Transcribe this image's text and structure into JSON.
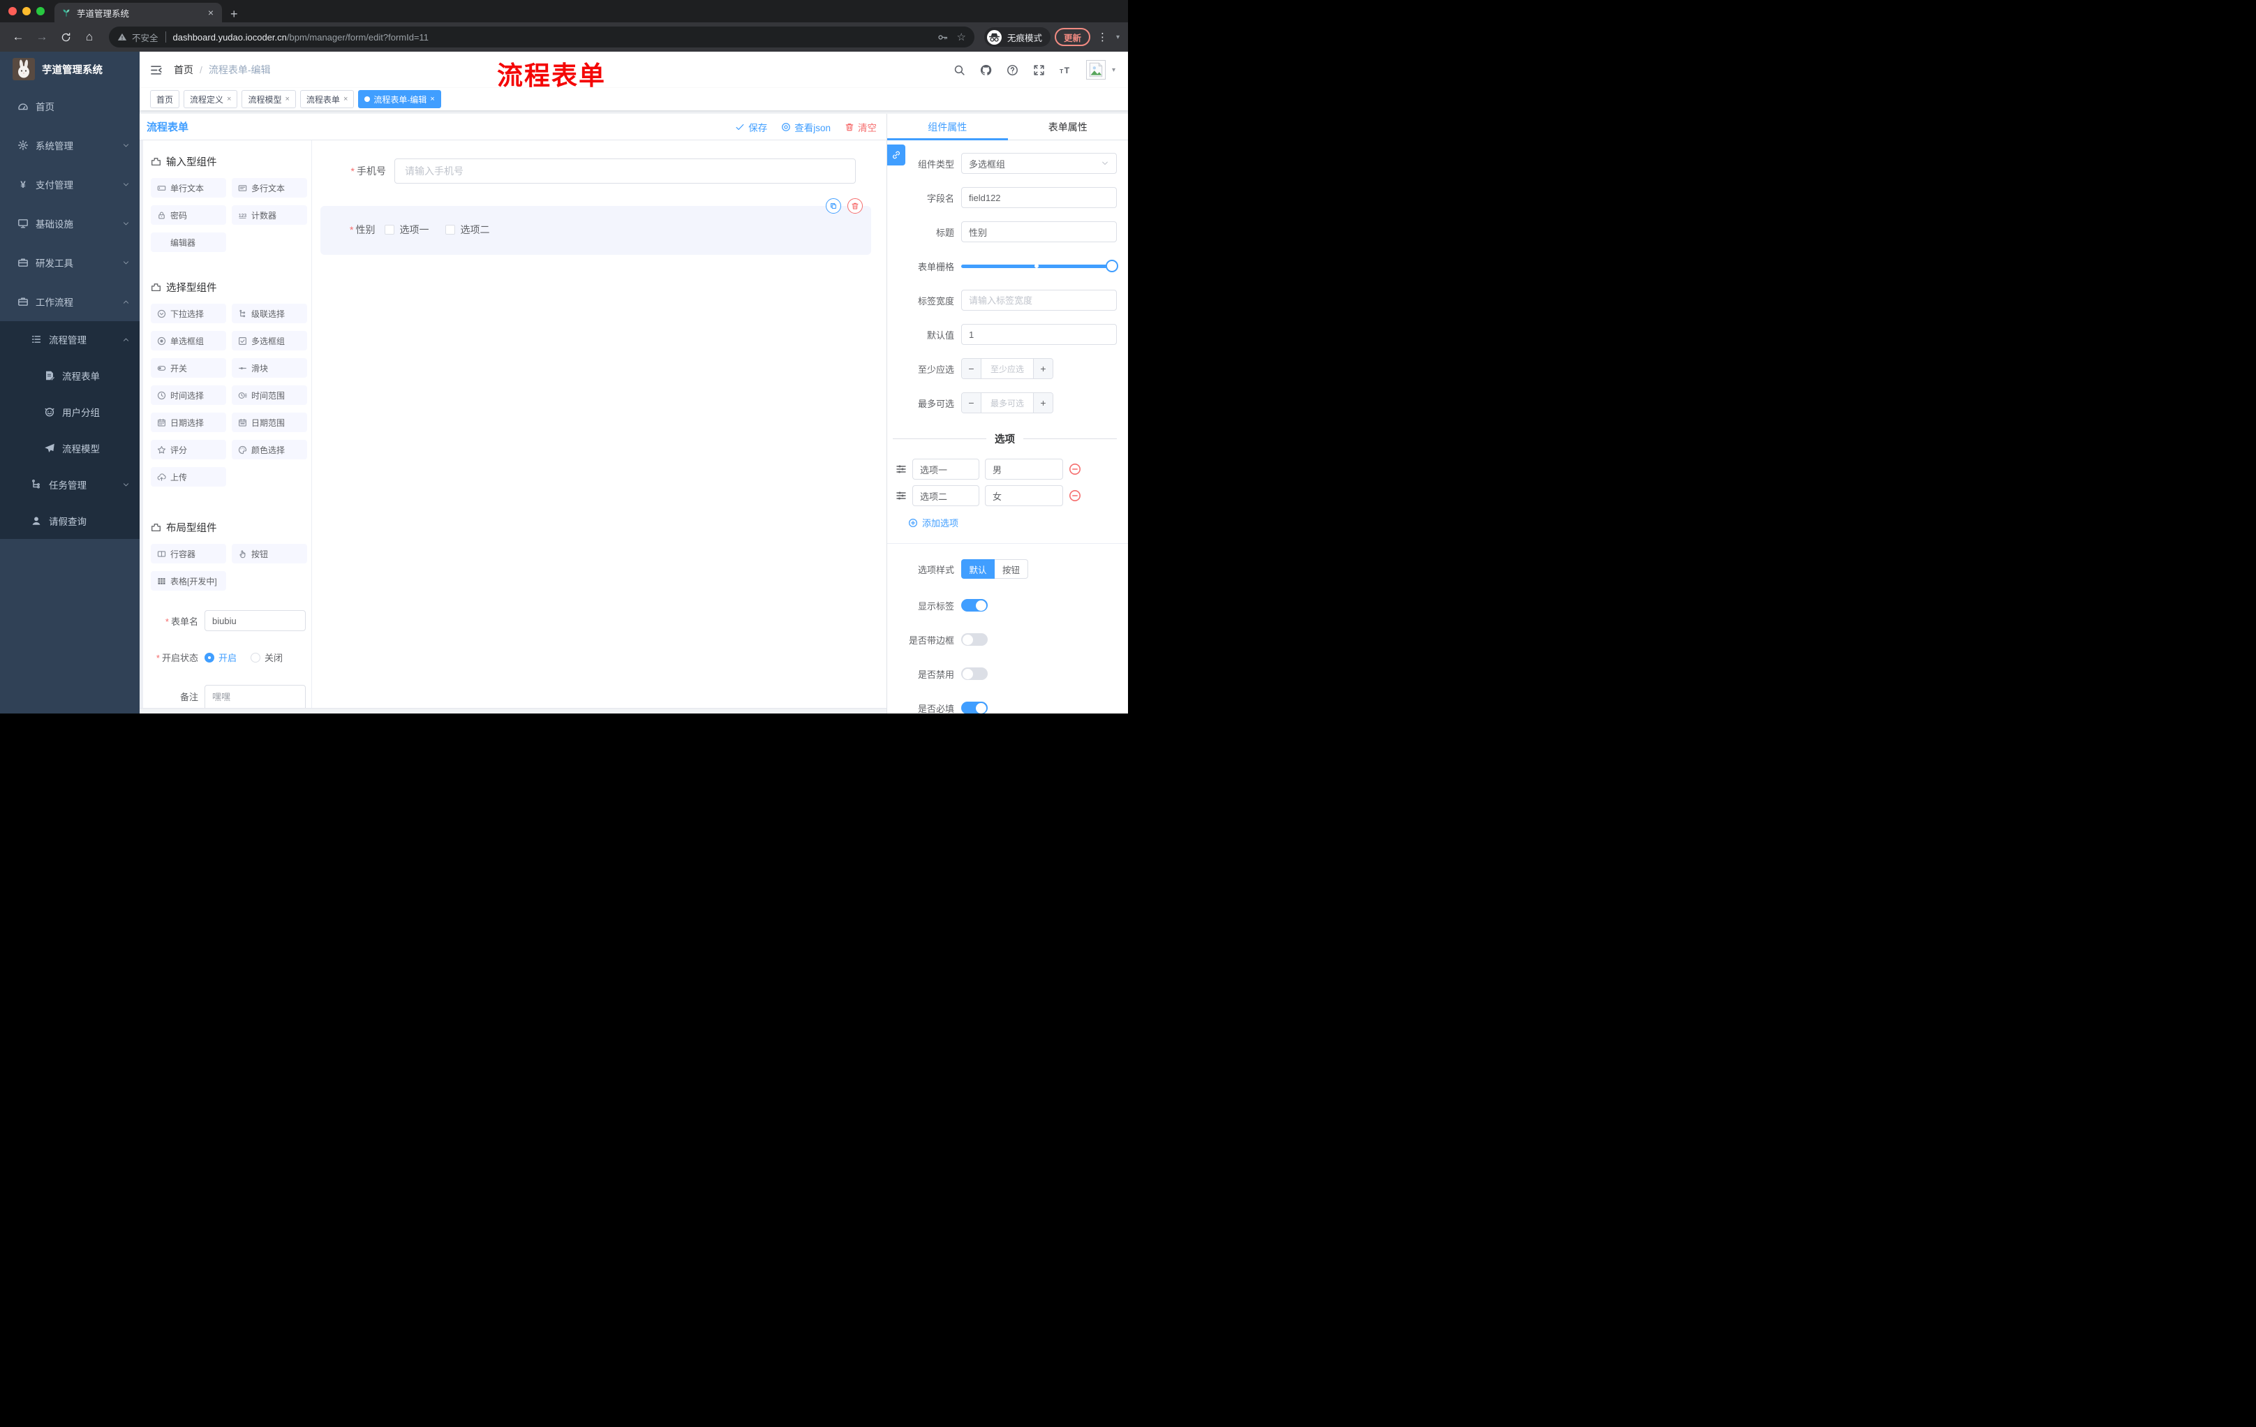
{
  "browser": {
    "tab_title": "芋道管理系统",
    "not_secure": "不安全",
    "url_host": "dashboard.yudao.iocoder.cn",
    "url_path": "/bpm/manager/form/edit?formId=11",
    "incognito": "无痕模式",
    "update": "更新"
  },
  "sidebar": {
    "app_title": "芋道管理系统",
    "items": [
      {
        "label": "首页",
        "icon": "dashboard-icon"
      },
      {
        "label": "系统管理",
        "icon": "gear-icon"
      },
      {
        "label": "支付管理",
        "icon": "yen-icon"
      },
      {
        "label": "基础设施",
        "icon": "monitor-icon"
      },
      {
        "label": "研发工具",
        "icon": "briefcase-icon"
      },
      {
        "label": "工作流程",
        "icon": "briefcase-icon"
      },
      {
        "label": "流程管理",
        "icon": "list-icon"
      },
      {
        "label": "流程表单",
        "icon": "doc-edit-icon"
      },
      {
        "label": "用户分组",
        "icon": "robot-icon"
      },
      {
        "label": "流程模型",
        "icon": "paper-plane-icon"
      },
      {
        "label": "任务管理",
        "icon": "tree-icon"
      },
      {
        "label": "请假查询",
        "icon": "user-icon"
      }
    ]
  },
  "header": {
    "breadcrumb_home": "首页",
    "breadcrumb_current": "流程表单-编辑",
    "watermark": "流程表单"
  },
  "tags": [
    {
      "label": "首页",
      "closable": false,
      "active": false
    },
    {
      "label": "流程定义",
      "closable": true,
      "active": false
    },
    {
      "label": "流程模型",
      "closable": true,
      "active": false
    },
    {
      "label": "流程表单",
      "closable": true,
      "active": false
    },
    {
      "label": "流程表单-编辑",
      "closable": true,
      "active": true
    }
  ],
  "toolbar": {
    "title": "流程表单",
    "save": "保存",
    "view_json": "查看json",
    "clear": "清空"
  },
  "components": {
    "g1": {
      "title": "输入型组件",
      "items": [
        {
          "label": "单行文本",
          "icon": "input-icon"
        },
        {
          "label": "多行文本",
          "icon": "textarea-icon"
        },
        {
          "label": "密码",
          "icon": "lock-icon"
        },
        {
          "label": "计数器",
          "icon": "counter-icon"
        },
        {
          "label": "编辑器",
          "icon": ""
        }
      ]
    },
    "g2": {
      "title": "选择型组件",
      "items": [
        {
          "label": "下拉选择",
          "icon": "select-icon"
        },
        {
          "label": "级联选择",
          "icon": "cascader-icon"
        },
        {
          "label": "单选框组",
          "icon": "radio-icon"
        },
        {
          "label": "多选框组",
          "icon": "checkbox-icon"
        },
        {
          "label": "开关",
          "icon": "switch-icon"
        },
        {
          "label": "滑块",
          "icon": "slider-icon"
        },
        {
          "label": "时间选择",
          "icon": "time-icon"
        },
        {
          "label": "时间范围",
          "icon": "time-range-icon"
        },
        {
          "label": "日期选择",
          "icon": "date-icon"
        },
        {
          "label": "日期范围",
          "icon": "date-range-icon"
        },
        {
          "label": "评分",
          "icon": "star-icon"
        },
        {
          "label": "颜色选择",
          "icon": "palette-icon"
        },
        {
          "label": "上传",
          "icon": "upload-icon"
        }
      ]
    },
    "g3": {
      "title": "布局型组件",
      "items": [
        {
          "label": "行容器",
          "icon": "row-icon"
        },
        {
          "label": "按钮",
          "icon": "hand-icon"
        },
        {
          "label": "表格[开发中]",
          "icon": "table-icon"
        }
      ]
    }
  },
  "meta": {
    "name_label": "表单名",
    "name_value": "biubiu",
    "status_label": "开启状态",
    "status_on": "开启",
    "status_off": "关闭",
    "remark_label": "备注",
    "remark_value": "嘿嘿"
  },
  "canvas": {
    "phone_label": "手机号",
    "phone_placeholder": "请输入手机号",
    "gender_label": "性别",
    "option1": "选项一",
    "option2": "选项二"
  },
  "props": {
    "tab_component": "组件属性",
    "tab_form": "表单属性",
    "type": {
      "label": "组件类型",
      "value": "多选框组"
    },
    "field": {
      "label": "字段名",
      "value": "field122"
    },
    "title": {
      "label": "标题",
      "value": "性别"
    },
    "grid": {
      "label": "表单栅格"
    },
    "width": {
      "label": "标签宽度",
      "placeholder": "请输入标签宽度"
    },
    "default": {
      "label": "默认值",
      "value": "1"
    },
    "min": {
      "label": "至少应选",
      "placeholder": "至少应选"
    },
    "max": {
      "label": "最多可选",
      "placeholder": "最多可选"
    },
    "options": {
      "title": "选项",
      "rows": [
        {
          "name": "选项一",
          "value": "男"
        },
        {
          "name": "选项二",
          "value": "女"
        }
      ],
      "add": "添加选项"
    },
    "style": {
      "label": "选项样式",
      "opt_default": "默认",
      "opt_button": "按钮"
    },
    "toggles": [
      {
        "label": "显示标签",
        "on": true
      },
      {
        "label": "是否带边框",
        "on": false
      },
      {
        "label": "是否禁用",
        "on": false
      },
      {
        "label": "是否必填",
        "on": true
      }
    ]
  }
}
